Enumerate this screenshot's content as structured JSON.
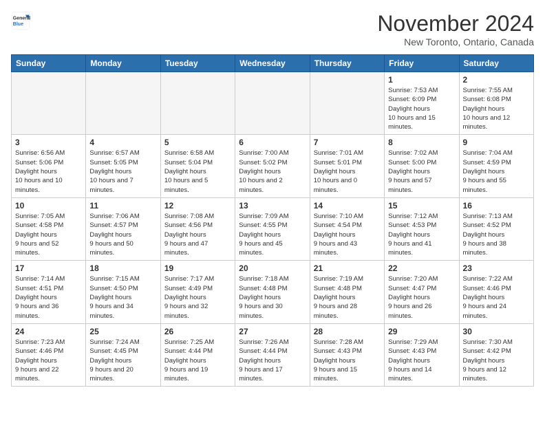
{
  "logo": {
    "general": "General",
    "blue": "Blue"
  },
  "header": {
    "month": "November 2024",
    "location": "New Toronto, Ontario, Canada"
  },
  "weekdays": [
    "Sunday",
    "Monday",
    "Tuesday",
    "Wednesday",
    "Thursday",
    "Friday",
    "Saturday"
  ],
  "weeks": [
    [
      {
        "day": "",
        "empty": true
      },
      {
        "day": "",
        "empty": true
      },
      {
        "day": "",
        "empty": true
      },
      {
        "day": "",
        "empty": true
      },
      {
        "day": "",
        "empty": true
      },
      {
        "day": "1",
        "sunrise": "7:53 AM",
        "sunset": "6:09 PM",
        "daylight": "10 hours and 15 minutes."
      },
      {
        "day": "2",
        "sunrise": "7:55 AM",
        "sunset": "6:08 PM",
        "daylight": "10 hours and 12 minutes."
      }
    ],
    [
      {
        "day": "3",
        "sunrise": "6:56 AM",
        "sunset": "5:06 PM",
        "daylight": "10 hours and 10 minutes."
      },
      {
        "day": "4",
        "sunrise": "6:57 AM",
        "sunset": "5:05 PM",
        "daylight": "10 hours and 7 minutes."
      },
      {
        "day": "5",
        "sunrise": "6:58 AM",
        "sunset": "5:04 PM",
        "daylight": "10 hours and 5 minutes."
      },
      {
        "day": "6",
        "sunrise": "7:00 AM",
        "sunset": "5:02 PM",
        "daylight": "10 hours and 2 minutes."
      },
      {
        "day": "7",
        "sunrise": "7:01 AM",
        "sunset": "5:01 PM",
        "daylight": "10 hours and 0 minutes."
      },
      {
        "day": "8",
        "sunrise": "7:02 AM",
        "sunset": "5:00 PM",
        "daylight": "9 hours and 57 minutes."
      },
      {
        "day": "9",
        "sunrise": "7:04 AM",
        "sunset": "4:59 PM",
        "daylight": "9 hours and 55 minutes."
      }
    ],
    [
      {
        "day": "10",
        "sunrise": "7:05 AM",
        "sunset": "4:58 PM",
        "daylight": "9 hours and 52 minutes."
      },
      {
        "day": "11",
        "sunrise": "7:06 AM",
        "sunset": "4:57 PM",
        "daylight": "9 hours and 50 minutes."
      },
      {
        "day": "12",
        "sunrise": "7:08 AM",
        "sunset": "4:56 PM",
        "daylight": "9 hours and 47 minutes."
      },
      {
        "day": "13",
        "sunrise": "7:09 AM",
        "sunset": "4:55 PM",
        "daylight": "9 hours and 45 minutes."
      },
      {
        "day": "14",
        "sunrise": "7:10 AM",
        "sunset": "4:54 PM",
        "daylight": "9 hours and 43 minutes."
      },
      {
        "day": "15",
        "sunrise": "7:12 AM",
        "sunset": "4:53 PM",
        "daylight": "9 hours and 41 minutes."
      },
      {
        "day": "16",
        "sunrise": "7:13 AM",
        "sunset": "4:52 PM",
        "daylight": "9 hours and 38 minutes."
      }
    ],
    [
      {
        "day": "17",
        "sunrise": "7:14 AM",
        "sunset": "4:51 PM",
        "daylight": "9 hours and 36 minutes."
      },
      {
        "day": "18",
        "sunrise": "7:15 AM",
        "sunset": "4:50 PM",
        "daylight": "9 hours and 34 minutes."
      },
      {
        "day": "19",
        "sunrise": "7:17 AM",
        "sunset": "4:49 PM",
        "daylight": "9 hours and 32 minutes."
      },
      {
        "day": "20",
        "sunrise": "7:18 AM",
        "sunset": "4:48 PM",
        "daylight": "9 hours and 30 minutes."
      },
      {
        "day": "21",
        "sunrise": "7:19 AM",
        "sunset": "4:48 PM",
        "daylight": "9 hours and 28 minutes."
      },
      {
        "day": "22",
        "sunrise": "7:20 AM",
        "sunset": "4:47 PM",
        "daylight": "9 hours and 26 minutes."
      },
      {
        "day": "23",
        "sunrise": "7:22 AM",
        "sunset": "4:46 PM",
        "daylight": "9 hours and 24 minutes."
      }
    ],
    [
      {
        "day": "24",
        "sunrise": "7:23 AM",
        "sunset": "4:46 PM",
        "daylight": "9 hours and 22 minutes."
      },
      {
        "day": "25",
        "sunrise": "7:24 AM",
        "sunset": "4:45 PM",
        "daylight": "9 hours and 20 minutes."
      },
      {
        "day": "26",
        "sunrise": "7:25 AM",
        "sunset": "4:44 PM",
        "daylight": "9 hours and 19 minutes."
      },
      {
        "day": "27",
        "sunrise": "7:26 AM",
        "sunset": "4:44 PM",
        "daylight": "9 hours and 17 minutes."
      },
      {
        "day": "28",
        "sunrise": "7:28 AM",
        "sunset": "4:43 PM",
        "daylight": "9 hours and 15 minutes."
      },
      {
        "day": "29",
        "sunrise": "7:29 AM",
        "sunset": "4:43 PM",
        "daylight": "9 hours and 14 minutes."
      },
      {
        "day": "30",
        "sunrise": "7:30 AM",
        "sunset": "4:42 PM",
        "daylight": "9 hours and 12 minutes."
      }
    ]
  ]
}
